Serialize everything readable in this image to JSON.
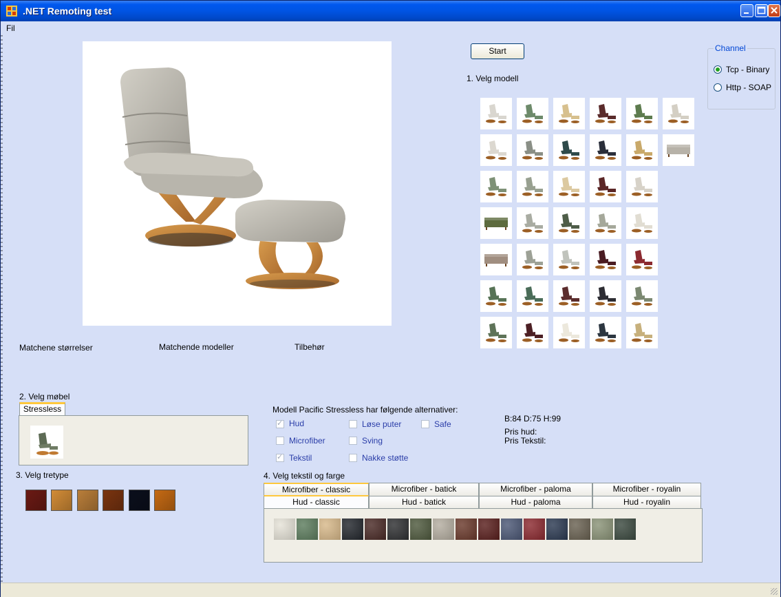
{
  "window": {
    "title": ".NET Remoting test"
  },
  "menu": {
    "file": "Fil"
  },
  "start_button": "Start",
  "step1_label": "1. Velg modell",
  "channel": {
    "legend": "Channel",
    "options": [
      {
        "label": "Tcp - Binary",
        "selected": true
      },
      {
        "label": "Http - SOAP",
        "selected": false
      }
    ]
  },
  "model_grid": {
    "colors": [
      [
        "#d9d6cf",
        "#6d8a6a",
        "#d7c08e",
        "#5a2b2b",
        "#5d7b4e",
        "#d4cfc4"
      ],
      [
        "#dcd8d0",
        "#8a8f86",
        "#2e4a4a",
        "#2a2e3a",
        "#c9a96a",
        "#b7b2a8"
      ],
      [
        "#7e9176",
        "#98a090",
        "#dcc9a0",
        "#5b2626",
        "#d7d2c8",
        null
      ],
      [
        "#5d6b3e",
        "#a9aca2",
        "#4e5d48",
        "#a5a89a",
        "#e1ddd2",
        null
      ],
      [
        "#a08e80",
        "#9da196",
        "#c0c3bc",
        "#4a1c22",
        "#8c2a30",
        null
      ],
      [
        "#577356",
        "#4a6c58",
        "#5b2c2c",
        "#2d2d33",
        "#7b8871",
        null
      ],
      [
        "#5e7358",
        "#4c1f24",
        "#ece8dc",
        "#2c3640",
        "#c7b07c",
        null
      ]
    ],
    "row4_sofa_index": 0,
    "row2_sofa_index": 5,
    "row5_sofa_index": 0
  },
  "matching_labels": {
    "sizes": "Matchene størrelser",
    "models": "Matchende modeller",
    "accessories": "Tilbehør"
  },
  "step2": {
    "label": "2. Velg møbel",
    "tab": "Stressless"
  },
  "step3": {
    "label": "3. Velg tretype",
    "woods": [
      "#6b1a14",
      "#d28c37",
      "#b97e3a",
      "#7a3410",
      "#0b0f1c",
      "#c56a14"
    ]
  },
  "alternatives": {
    "heading": "Modell Pacific Stressless har følgende alternativer:",
    "options": [
      {
        "label": "Hud",
        "checked": true
      },
      {
        "label": "Løse puter",
        "checked": false
      },
      {
        "label": "Safe",
        "checked": false
      },
      {
        "label": "Microfiber",
        "checked": false
      },
      {
        "label": "Sving",
        "checked": false
      },
      {
        "label": "Tekstil",
        "checked": true
      },
      {
        "label": "Nakke støtte",
        "checked": false
      }
    ]
  },
  "info": {
    "dimensions": "B:84 D:75 H:99",
    "price_leather": "Pris hud:",
    "price_textile": "Pris Tekstil:"
  },
  "step4": {
    "label": "4. Velg tekstil og farge",
    "tabs_row1": [
      "Microfiber - classic",
      "Microfiber - batick",
      "Microfiber - paloma",
      "Microfiber - royalin"
    ],
    "tabs_row2": [
      "Hud - classic",
      "Hud - batick",
      "Hud - paloma",
      "Hud - royalin"
    ],
    "active_tab": "Hud - classic",
    "colors": [
      "#e6e3d8",
      "#5d7d5e",
      "#d8b98a",
      "#23272d",
      "#4a2a26",
      "#2f3032",
      "#4f5a3e",
      "#b5aea1",
      "#6b3a2c",
      "#5a1f1d",
      "#4c5876",
      "#8c2a30",
      "#2c3a52",
      "#6a6252",
      "#8b9478",
      "#3c4a40"
    ]
  }
}
